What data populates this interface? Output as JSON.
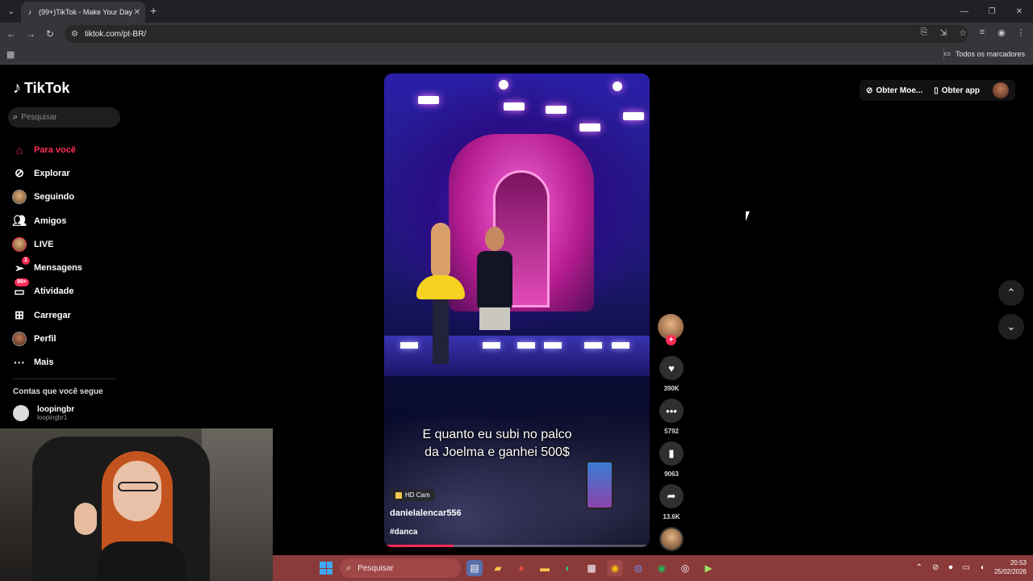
{
  "browser": {
    "tab_title": "(99+)TikTok - Make Your Day",
    "url": "tiktok.com/pt-BR/",
    "bookmarks_all": "Todos os marcadores"
  },
  "sidebar": {
    "logo": "TikTok",
    "search_placeholder": "Pesquisar",
    "items": [
      {
        "label": "Para você",
        "icon": "home-icon",
        "active": true
      },
      {
        "label": "Explorar",
        "icon": "compass-icon"
      },
      {
        "label": "Seguindo",
        "icon": "avatar"
      },
      {
        "label": "Amigos",
        "icon": "friends-icon"
      },
      {
        "label": "LIVE",
        "icon": "avatar"
      },
      {
        "label": "Mensagens",
        "icon": "messages-icon",
        "badge": "1"
      },
      {
        "label": "Atividade",
        "icon": "activity-icon",
        "badge": "99+"
      },
      {
        "label": "Carregar",
        "icon": "upload-icon"
      },
      {
        "label": "Perfil",
        "icon": "avatar"
      },
      {
        "label": "Mais",
        "icon": "more-icon"
      }
    ],
    "following_header": "Contas que você segue",
    "following": [
      {
        "name": "loopingbr",
        "username": "loopingbr1"
      }
    ]
  },
  "video": {
    "caption_line1": "E quanto eu subi no palco",
    "caption_line2": "da Joelma e ganhei 500$",
    "hd_label": "HD Cam",
    "username": "danielalencar556",
    "hashtag": "#danca",
    "progress": 0.26
  },
  "actions": {
    "likes": "390K",
    "comments": "5792",
    "saves": "9063",
    "shares": "13.6K"
  },
  "header_right": {
    "coins": "Obter Moe...",
    "app": "Obter app"
  },
  "taskbar": {
    "search": "Pesquisar",
    "time": "20:53",
    "date": "25/02/2026"
  },
  "colors": {
    "accent": "#fe2c55",
    "taskbar": "#8b3a3a"
  }
}
